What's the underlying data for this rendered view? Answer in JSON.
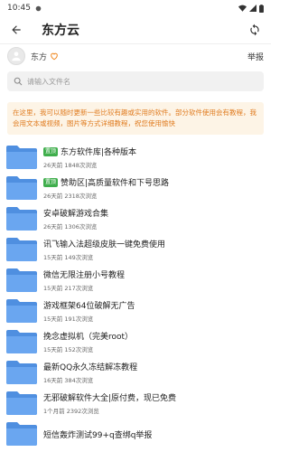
{
  "status": {
    "time": "10:45"
  },
  "header": {
    "title": "东方云"
  },
  "owner": {
    "name": "东方",
    "report_label": "举报"
  },
  "search": {
    "placeholder": "请输入文件名"
  },
  "notice": {
    "text": "在这里，我可以随时更新一些比较有趣或实用的软件。部分软件使用会有教程，我会用文本或视频，图片等方式详细教程，祝您使用愉快"
  },
  "colors": {
    "notice_bg": "#fdf4e6",
    "notice_text": "#e07b1f",
    "pin_tag": "#3fae4c",
    "folder": "#5b9be9"
  },
  "files": [
    {
      "pinned": true,
      "pin_label": "置顶",
      "name": "东方软件库|各种版本",
      "meta": "26天前 1848次浏览"
    },
    {
      "pinned": true,
      "pin_label": "置顶",
      "name": "赞助区|高质量软件和下号思路",
      "meta": "26天前 2318次浏览"
    },
    {
      "pinned": false,
      "pin_label": "",
      "name": "安卓破解游戏合集",
      "meta": "26天前 1306次浏览"
    },
    {
      "pinned": false,
      "pin_label": "",
      "name": "讯飞输入法超级皮肤一键免费使用",
      "meta": "15天前 149次浏览"
    },
    {
      "pinned": false,
      "pin_label": "",
      "name": "微信无限注册小号教程",
      "meta": "15天前 217次浏览"
    },
    {
      "pinned": false,
      "pin_label": "",
      "name": "游戏框架64位破解无广告",
      "meta": "15天前 191次浏览"
    },
    {
      "pinned": false,
      "pin_label": "",
      "name": "挽念虚拟机（完美root）",
      "meta": "15天前 152次浏览"
    },
    {
      "pinned": false,
      "pin_label": "",
      "name": "最新QQ永久冻结解冻教程",
      "meta": "16天前 384次浏览"
    },
    {
      "pinned": false,
      "pin_label": "",
      "name": "无邪破解软件大全|原付费，现已免费",
      "meta": "1个月前 2392次浏览"
    },
    {
      "pinned": false,
      "pin_label": "",
      "name": "短信轰炸测试99+q查绑q举报",
      "meta": ""
    }
  ]
}
